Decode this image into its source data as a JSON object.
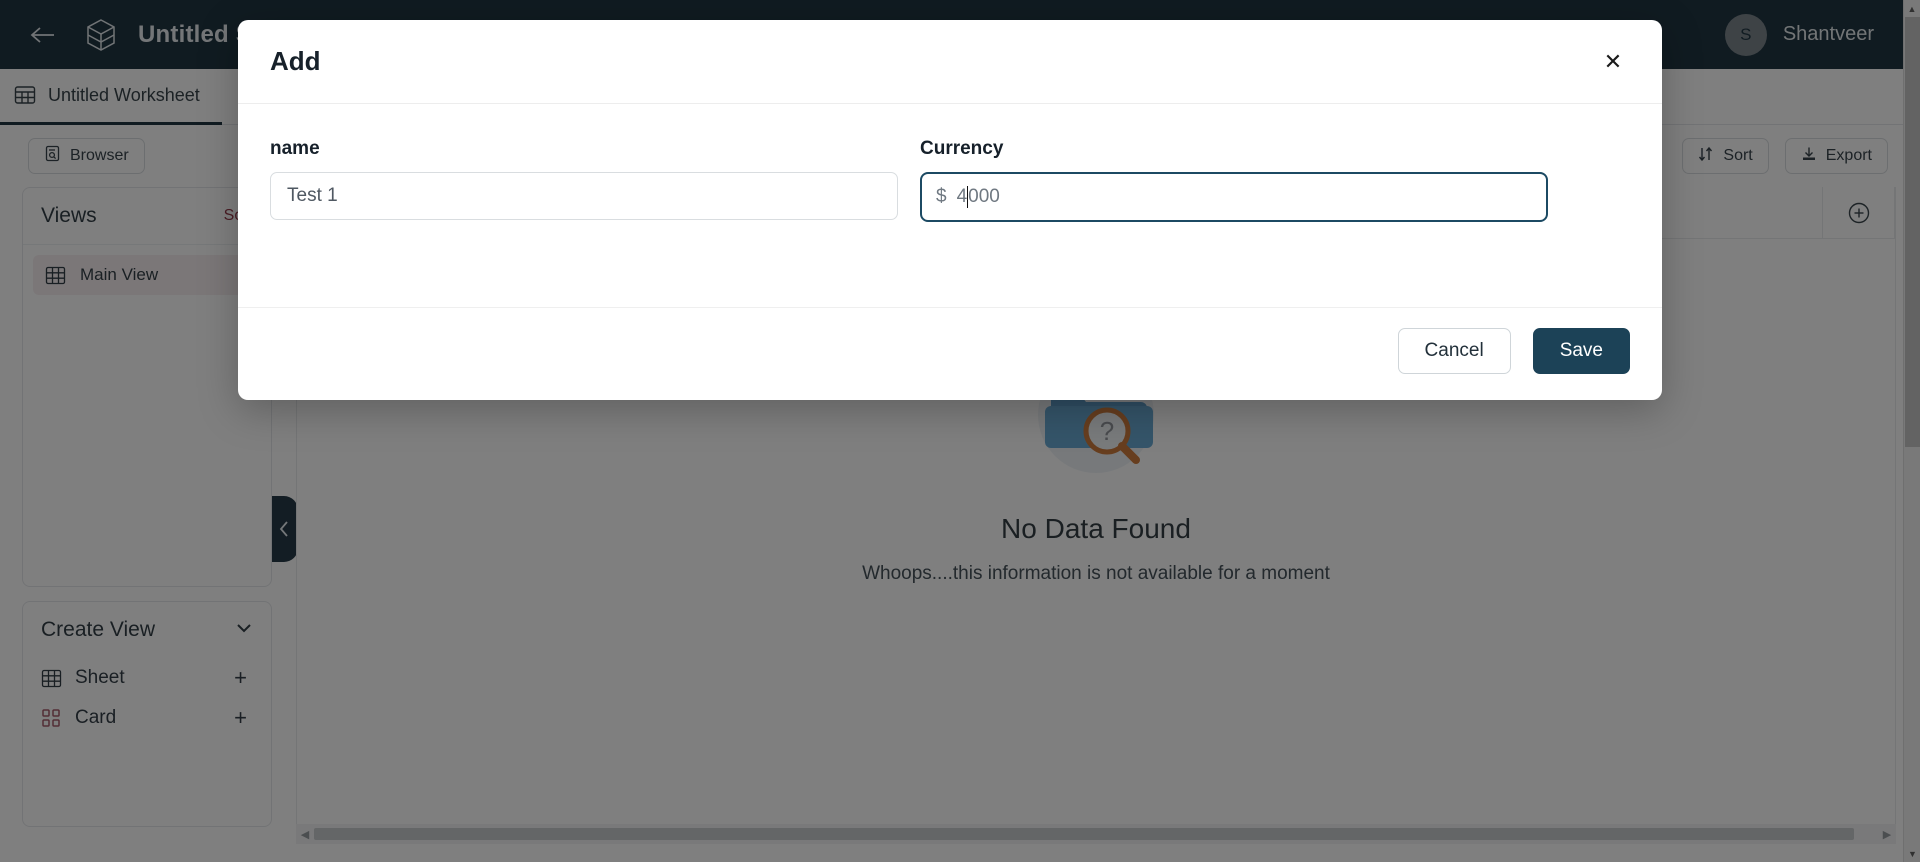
{
  "topbar": {
    "back_icon": "arrow-left-icon",
    "logo_icon": "cube-logo-icon",
    "title": "Untitled Sche",
    "title_full": "Untitled Schema",
    "user": {
      "initial": "S",
      "name": "Shantveer"
    }
  },
  "tabstrip": {
    "worksheet_icon": "table-icon",
    "worksheet_label": "Untitled Worksheet"
  },
  "toolbar": {
    "browser_label": "Browser",
    "browser_icon": "browser-icon",
    "sort_label": "Sort",
    "sort_icon": "sort-icon",
    "export_label": "Export",
    "export_icon": "download-icon"
  },
  "sidebar": {
    "views": {
      "title": "Views",
      "sort_label": "Sort",
      "sort_color": "#8a2437",
      "items": [
        {
          "label": "Main View",
          "icon": "grid-icon",
          "selected": true
        }
      ]
    },
    "create_view": {
      "title": "Create View",
      "chevron_icon": "chevron-down-icon",
      "items": [
        {
          "label": "Sheet",
          "icon": "grid-icon",
          "action": "+"
        },
        {
          "label": "Card",
          "icon": "card-grid-icon",
          "action": "+"
        }
      ]
    },
    "collapse_icon": "chevron-left-icon"
  },
  "grid": {
    "add_column_icon": "plus-circle-icon",
    "empty_state": {
      "illustration": "folder-search-icon",
      "title": "No Data Found",
      "subtitle": "Whoops....this information is not available for a moment"
    },
    "scrollbar": {
      "left_arrow": "◀",
      "right_arrow": "▶"
    }
  },
  "modal": {
    "title": "Add",
    "close_icon": "close-icon",
    "fields": [
      {
        "label": "name",
        "name": "name-input",
        "value": "Test 1",
        "placeholder": "Test 1",
        "focused": false
      },
      {
        "label": "Currency",
        "name": "currency-input",
        "symbol": "$",
        "value_before_caret": "4",
        "value_after_caret": "000",
        "value": "4000",
        "focused": true,
        "focus_border_color": "#1c4a63"
      }
    ],
    "buttons": {
      "cancel_label": "Cancel",
      "save_label": "Save",
      "save_bg": "#1c4257"
    }
  },
  "colors": {
    "topbar_bg": "#0b2230",
    "accent_dark": "#1c4257",
    "sort_red": "#8a2437",
    "folder_blue": "#4e93c4",
    "magnifier_orange": "#c9702a"
  }
}
